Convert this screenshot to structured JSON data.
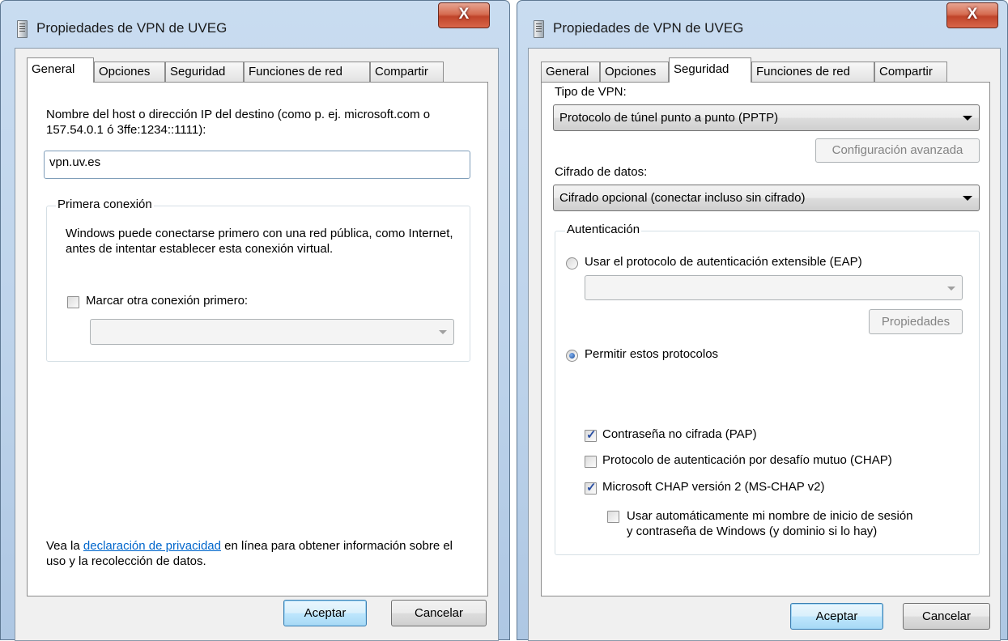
{
  "left_window": {
    "title": "Propiedades de VPN de UVEG",
    "close_label": "X",
    "tabs": [
      "General",
      "Opciones",
      "Seguridad",
      "Funciones de red",
      "Compartir"
    ],
    "active_tab": "General",
    "host_label": "Nombre del host o dirección IP del destino (como p. ej. microsoft.com o 157.54.0.1 ó 3ffe:1234::1111):",
    "host_value": "vpn.uv.es",
    "first_connection": {
      "legend": "Primera conexión",
      "description": "Windows puede conectarse primero con una red pública, como Internet, antes de intentar establecer esta conexión virtual.",
      "dial_other_label": "Marcar otra conexión primero:",
      "dial_other_checked": false,
      "dial_other_select_value": ""
    },
    "privacy_prefix": "Vea la",
    "privacy_link": "declaración de privacidad",
    "privacy_suffix": "en línea para obtener información sobre el uso y la recolección de datos.",
    "ok_label": "Aceptar",
    "cancel_label": "Cancelar"
  },
  "right_window": {
    "title": "Propiedades de VPN de UVEG",
    "close_label": "X",
    "tabs": [
      "General",
      "Opciones",
      "Seguridad",
      "Funciones de red",
      "Compartir"
    ],
    "active_tab": "Seguridad",
    "vpn_type_label": "Tipo de VPN:",
    "vpn_type_value": "Protocolo de túnel punto a punto (PPTP)",
    "advanced_button": "Configuración avanzada",
    "encryption_label": "Cifrado de datos:",
    "encryption_value": "Cifrado opcional (conectar incluso sin cifrado)",
    "authentication": {
      "legend": "Autenticación",
      "eap_label": "Usar el protocolo de autenticación extensible (EAP)",
      "eap_selected": false,
      "eap_select_value": "",
      "properties_button": "Propiedades",
      "allow_label": "Permitir estos protocolos",
      "allow_selected": true,
      "protocols": [
        {
          "label": "Contraseña no cifrada (PAP)",
          "checked": true
        },
        {
          "label": "Protocolo de autenticación por desafío mutuo (CHAP)",
          "checked": false
        },
        {
          "label": "Microsoft CHAP versión 2 (MS-CHAP v2)",
          "checked": true
        }
      ],
      "auto_logon_line1": "Usar automáticamente mi nombre de inicio de sesión",
      "auto_logon_line2": "y contraseña de Windows (y dominio si lo hay)",
      "auto_logon_checked": false
    },
    "ok_label": "Aceptar",
    "cancel_label": "Cancelar"
  }
}
